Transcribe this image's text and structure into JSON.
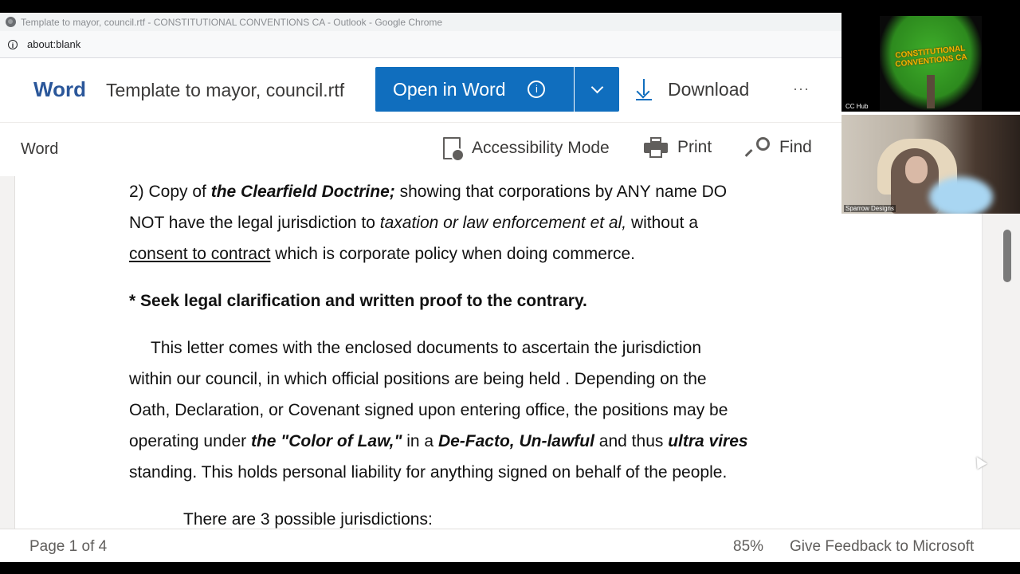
{
  "browser": {
    "window_title": "Template to mayor, council.rtf - CONSTITUTIONAL CONVENTIONS CA - Outlook - Google Chrome",
    "address": "about:blank"
  },
  "header": {
    "brand": "Word",
    "document_title": "Template to mayor, council.rtf",
    "open_in_word": "Open in Word",
    "info_glyph": "i",
    "download": "Download",
    "more": "···"
  },
  "toolbar": {
    "label": "Word",
    "accessibility_mode": "Accessibility Mode",
    "print": "Print",
    "find": "Find"
  },
  "document": {
    "p1": {
      "l1_a": "2) Copy of ",
      "l1_b": "the Clearfield Doctrine;",
      "l1_c": " showing that corporations by ANY name DO",
      "l2_a": "NOT have the legal jurisdiction to ",
      "l2_b": "taxation or law enforcement et al,",
      "l2_c": " without a",
      "l3_a": "consent to contract",
      "l3_b": " which is corporate policy when doing commerce."
    },
    "p2": "* Seek legal clarification and written proof to the contrary.",
    "p3": {
      "l1": "This letter comes with the enclosed documents to ascertain the jurisdiction",
      "l2": "within our council, in which official positions are being held . Depending on the",
      "l3": "Oath, Declaration, or Covenant signed upon entering office, the positions may be",
      "l4_a": "operating under ",
      "l4_b": "the \"Color of Law,\"",
      "l4_c": " in a ",
      "l4_d": "De-Facto, Un-lawful",
      "l4_e": " and thus ",
      "l4_f": "ultra vires",
      "l5": "standing. This holds personal liability for anything signed on behalf of the people."
    },
    "p4": "There are 3 possible jurisdictions:"
  },
  "status": {
    "page": "Page 1 of 4",
    "zoom": "85%",
    "feedback": "Give Feedback to Microsoft"
  },
  "video": {
    "tile1_name": "CC Hub",
    "tile1_logo_line1": "CONSTITUTIONAL",
    "tile1_logo_line2": "CONVENTIONS CA",
    "tile2_name": "Sparrow Designs"
  },
  "colors": {
    "brand_blue": "#2b579a",
    "button_blue": "#106ebe"
  }
}
